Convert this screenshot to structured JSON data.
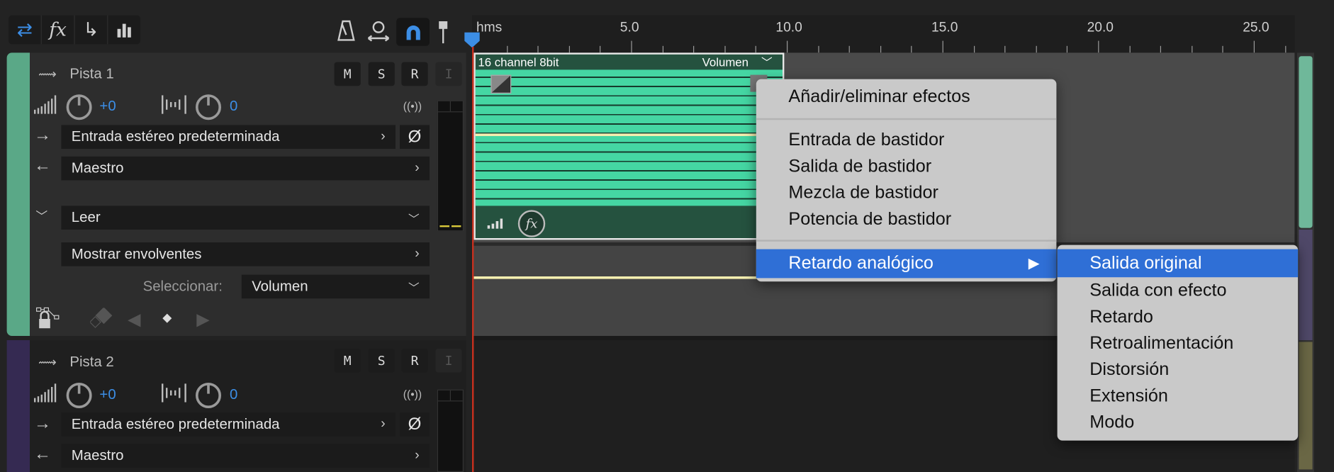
{
  "toolbar": {
    "left_buttons": [
      {
        "icon": "swap-arrows-icon",
        "glyph": "⇄",
        "active": true
      },
      {
        "icon": "fx-icon",
        "glyph": "fx",
        "active": false
      },
      {
        "icon": "send-arrow-icon",
        "glyph": "↳",
        "active": false
      },
      {
        "icon": "bars-chart-icon",
        "glyph": "▮",
        "active": false
      }
    ],
    "right_icons": [
      "metronome-icon",
      "time-stretch-icon",
      "snap-magnet-icon",
      "marker-icon"
    ]
  },
  "ruler": {
    "unit_label": "hms",
    "labels": [
      "5.0",
      "10.0",
      "15.0",
      "20.0",
      "25.0"
    ],
    "label_values": [
      5,
      10,
      15,
      20,
      25
    ],
    "max_seconds": 26.2,
    "playhead_seconds": 0
  },
  "tracks": [
    {
      "name": "Pista 1",
      "color": "#5aa887",
      "mute": "M",
      "solo": "S",
      "record": "R",
      "input_monitor": "I",
      "volume": "+0",
      "pan": "0",
      "input": "Entrada estéreo predeterminada",
      "output": "Maestro",
      "automation_mode": "Leer",
      "show_envelopes": "Mostrar envolventes",
      "select_label": "Seleccionar:",
      "select_value": "Volumen"
    },
    {
      "name": "Pista 2",
      "color": "#352a52",
      "mute": "M",
      "solo": "S",
      "record": "R",
      "input_monitor": "I",
      "volume": "+0",
      "pan": "0",
      "input": "Entrada estéreo predeterminada",
      "output": "Maestro"
    }
  ],
  "clip": {
    "name": "16 channel 8bit",
    "envelope": "Volumen",
    "start_seconds": 0,
    "end_seconds": 9.9
  },
  "context_menu": {
    "items": [
      "Añadir/eliminar efectos",
      "Entrada de bastidor",
      "Salida de bastidor",
      "Mezcla de bastidor",
      "Potencia de bastidor"
    ],
    "highlighted": "Retardo analógico",
    "submenu_arrow": "▶"
  },
  "submenu": {
    "items": [
      "Salida original",
      "Salida con efecto",
      "Retardo",
      "Retroalimentación",
      "Distorsión",
      "Extensión",
      "Modo"
    ],
    "highlighted_index": 0
  },
  "colors": {
    "accent": "#3c8ee6",
    "menu_highlight": "#2f6fd6",
    "clip_wave": "#45d6a3"
  }
}
